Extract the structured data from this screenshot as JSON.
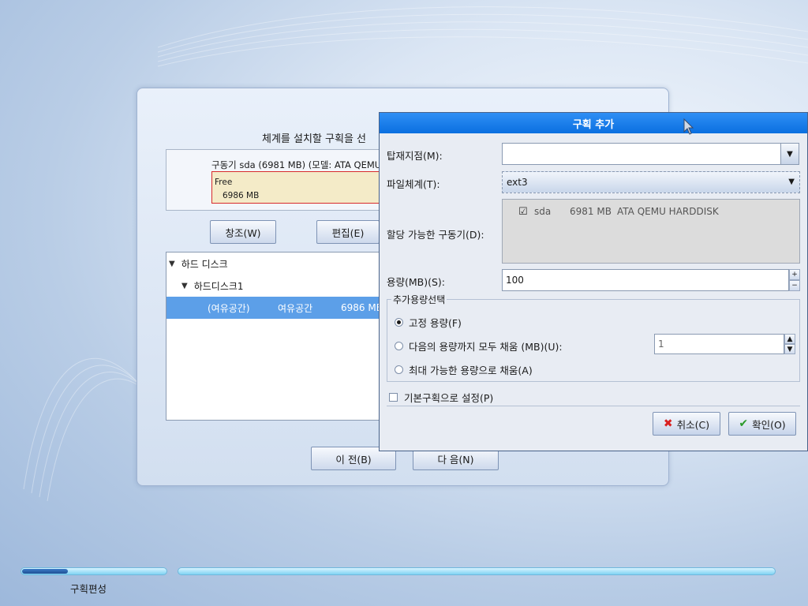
{
  "installer": {
    "title": "체계를 설치할 구획을 선",
    "disk_label": "구동기 sda (6981 MB) (모델: ATA QEMU",
    "free_name": "Free",
    "free_size": "6986 MB",
    "buttons": {
      "create": "창조(W)",
      "edit": "편집(E)"
    },
    "tree": {
      "root": "하드 디스크",
      "disk": "하드디스크1",
      "row": {
        "col1": "(여유공간)",
        "col2": "여유공간",
        "col3": "6986 MB"
      }
    },
    "nav": {
      "back": "이 전(B)",
      "next": "다 음(N)"
    }
  },
  "dialog": {
    "title": "구획 추가",
    "mount_label": "탑재지점(M):",
    "mount_value": "",
    "fs_label": "파일체계(T):",
    "fs_value": "ext3",
    "drives_label": "할당 가능한 구동기(D):",
    "drive": {
      "checked": true,
      "name": "sda",
      "size": "6981 MB",
      "model": "ATA QEMU HARDDISK"
    },
    "size_label": "용량(MB)(S):",
    "size_value": "100",
    "group_title": "추가용량선택",
    "options": {
      "fixed": "고정 용량(F)",
      "fill_to": "다음의 용량까지 모두 채움 (MB)(U):",
      "fill_to_value": "1",
      "fill_max": "최대 가능한 용량으로 채움(A)"
    },
    "primary_label": "기본구획으로 설정(P)",
    "cancel": "취소(C)",
    "ok": "확인(O)"
  },
  "progress": {
    "step_label": "구획편성",
    "step_fraction": 0.32
  },
  "colors": {
    "title_bar": "#0a6fe0",
    "selection": "#5c9fe8",
    "free_border": "#d82b2b",
    "free_fill": "#f4ebc8"
  }
}
